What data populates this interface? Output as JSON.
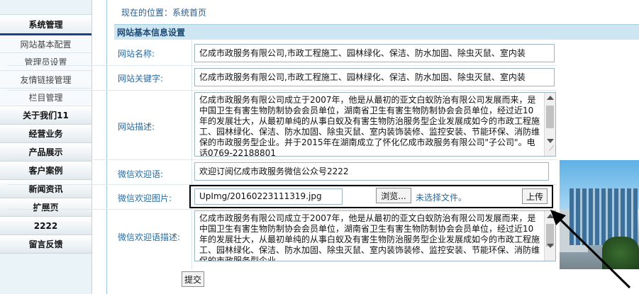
{
  "sidebar": {
    "header": "系统管理",
    "sub_items": [
      {
        "label": "网站基本配置"
      },
      {
        "label": "管理员设置"
      },
      {
        "label": "友情链接管理"
      },
      {
        "label": "栏目管理"
      }
    ],
    "main_items": [
      {
        "label": "关于我们11"
      },
      {
        "label": "经营业务"
      },
      {
        "label": "产品展示"
      },
      {
        "label": "客户案例"
      },
      {
        "label": "新闻资讯"
      },
      {
        "label": "扩展页"
      },
      {
        "label": "2222"
      },
      {
        "label": "留言反馈"
      }
    ]
  },
  "breadcrumb": "现在的位置：系统首页",
  "section_title": "网站基本信息设置",
  "form": {
    "site_name_label": "网站名称:",
    "site_name_value": "亿成市政服务有限公司,市政工程施工、园林绿化、保洁、防水加固、除虫灭鼠、室内装",
    "site_keywords_label": "网站关键字:",
    "site_keywords_value": "亿成市政服务有限公司,市政工程施工、园林绿化、保洁、防水加固、除虫灭鼠、室内装",
    "site_desc_label": "网站描述:",
    "site_desc_value": "亿成市政服务有限公司成立于2007年，他是从最初的亚文白蚁防治有限公司发展而来，是中国卫生有害生物防制协会会员单位，湖南省卫生有害生物防制协会会员单位，经过近10年的发展壮大，从最初单纯的从事白蚁及有害生物防治服务型企业发展成如今的市政工程施工、园林绿化、保洁、防水加固、除虫灭鼠、室内装饰装修、监控安装、节能环保、消防维保的市政服务型企业。并于2015年在湖南成立了怀化亿成市政服务有限公司\"子公司\"。电话0769-22188801",
    "wechat_welcome_label": "微信欢迎语:",
    "wechat_welcome_value": "欢迎订阅亿成市政服务微信公众号2222",
    "wechat_image_label": "微信欢迎图片:",
    "wechat_image_value": "UpImg/20160223111319.jpg",
    "browse_button": "浏览...",
    "no_file_text": "未选择文件。",
    "upload_button": "上传",
    "wechat_desc_label": "微信欢迎语描述:",
    "wechat_desc_value": "亿成市政服务有限公司成立于2007年，他是从最初的亚文白蚁防治有限公司发展而来，是中国卫生有害生物防制协会会员单位，湖南省卫生有害生物防制协会会员单位，经过近10年的发展壮大，从最初单纯的从事白蚁及有害生物防治服务型企业发展成如今的市政工程施工、园林绿化、保洁、防水加固、除虫灭鼠、室内装饰装修、监控安装、节能环保、消防维保的市政服务型企业。",
    "submit_button": "提交"
  },
  "colors": {
    "accent": "#1d3f8f",
    "label_blue": "#2a6ba0",
    "section_bg": "#cde6f2"
  }
}
